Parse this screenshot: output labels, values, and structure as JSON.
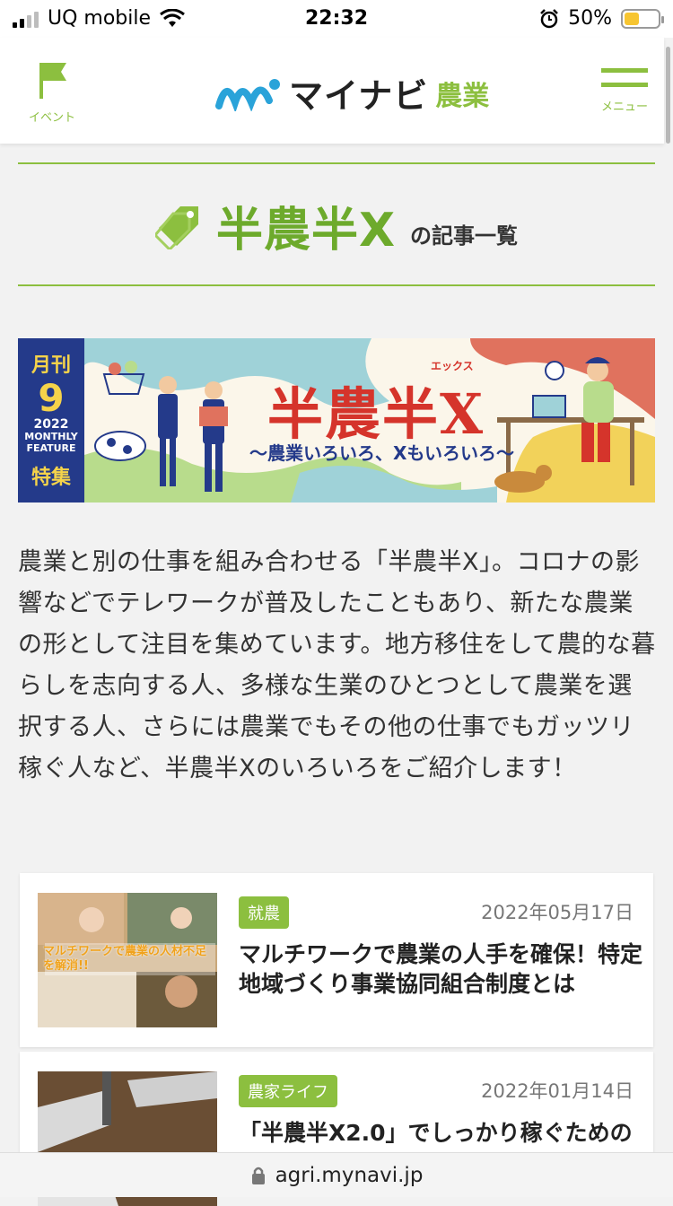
{
  "status_bar": {
    "carrier": "UQ mobile",
    "time": "22:32",
    "battery": "50%",
    "battery_level": 0.5
  },
  "header": {
    "event_label": "イベント",
    "brand": "マイナビ",
    "brand_sub": "農業",
    "menu_label": "メニュー"
  },
  "tag_heading": {
    "tag": "半農半X",
    "suffix": "の記事一覧"
  },
  "banner": {
    "month_label": "月刊",
    "month_number": "9",
    "year": "2022",
    "monthly": "MONTHLY",
    "feature": "FEATURE",
    "special": "特集",
    "title": "半農半X",
    "ruby": "エックス",
    "subtitle": "〜農業いろいろ、Xもいろいろ〜"
  },
  "description": "農業と別の仕事を組み合わせる「半農半X」。コロナの影響などでテレワークが普及したこともあり、新たな農業の形として注目を集めています。地方移住をして農的な暮らしを志向する人、多様な生業のひとつとして農業を選択する人、さらには農業でもその他の仕事でもガッツリ稼ぐ人など、半農半Xのいろいろをご紹介します！",
  "articles": [
    {
      "category": "就農",
      "date": "2022年05月17日",
      "title": "マルチワークで農業の人手を確保！特定地域づくり事業協同組合制度とは",
      "thumb_caption": "マルチワークで農業の人材不足を解消!!"
    },
    {
      "category": "農家ライフ",
      "date": "2022年01月14日",
      "title": "「半農半X2.0」でしっかり稼ぐための"
    }
  ],
  "url_bar": {
    "url": "agri.mynavi.jp"
  },
  "colors": {
    "accent": "#8cbf3f",
    "banner_navy": "#243a8a",
    "banner_red": "#d5342b"
  }
}
